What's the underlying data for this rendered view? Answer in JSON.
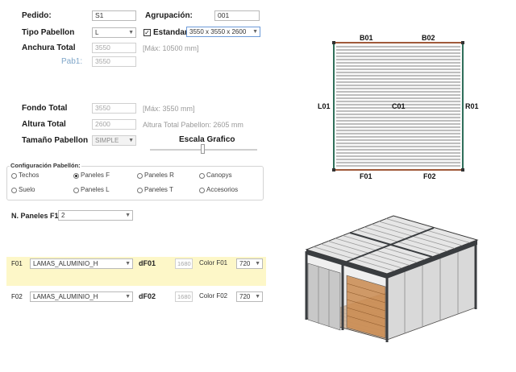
{
  "pedido": {
    "label": "Pedido:",
    "value": "S1"
  },
  "agrupacion": {
    "label": "Agrupación:",
    "value": "001"
  },
  "tipo_pabellon": {
    "label": "Tipo Pabellon",
    "value": "L"
  },
  "estandar": {
    "label": "Estandar",
    "checked": true,
    "value": "3550 x 3550 x 2600"
  },
  "anchura_total": {
    "label": "Anchura Total",
    "value": "3550",
    "max": "[Máx: 10500 mm]"
  },
  "pab1": {
    "label": "Pab1:",
    "value": "3550"
  },
  "fondo_total": {
    "label": "Fondo Total",
    "value": "3550",
    "max": "[Máx: 3550 mm]"
  },
  "altura_total": {
    "label": "Altura Total",
    "value": "2600",
    "note": "Altura Total Pabellon: 2605 mm"
  },
  "tamano_pabellon": {
    "label": "Tamaño Pabellon",
    "value": "SIMPLE"
  },
  "escala_grafico": {
    "label": "Escala Grafico",
    "level": 0.5
  },
  "configuracion": {
    "title": "Configuración Pabellón:",
    "options": [
      {
        "label": "Techos",
        "selected": false
      },
      {
        "label": "Paneles F",
        "selected": true
      },
      {
        "label": "Paneles R",
        "selected": false
      },
      {
        "label": "Canopys",
        "selected": false
      },
      {
        "label": "Suelo",
        "selected": false
      },
      {
        "label": "Paneles L",
        "selected": false
      },
      {
        "label": "Paneles T",
        "selected": false
      },
      {
        "label": "Accesorios",
        "selected": false
      }
    ]
  },
  "n_paneles": {
    "label": "N. Paneles F1",
    "value": "2"
  },
  "panels": [
    {
      "id": "F01",
      "type": "LAMAS_ALUMINIO_H",
      "d_label": "dF01",
      "d_value": "1680",
      "color_label": "Color F01",
      "color_value": "720",
      "highlight": true
    },
    {
      "id": "F02",
      "type": "LAMAS_ALUMINIO_H",
      "d_label": "dF02",
      "d_value": "1680",
      "color_label": "Color F02",
      "color_value": "720",
      "highlight": false
    }
  ],
  "drawing": {
    "top": [
      "B01",
      "B02"
    ],
    "left": "L01",
    "center": "C01",
    "right": "R01",
    "bottom": [
      "F01",
      "F02"
    ]
  },
  "colors": {
    "highlight": "#fdf7c8",
    "select_border": "#6c9ad8",
    "wood": "#c98a4f",
    "frame": "#3a3d40"
  }
}
